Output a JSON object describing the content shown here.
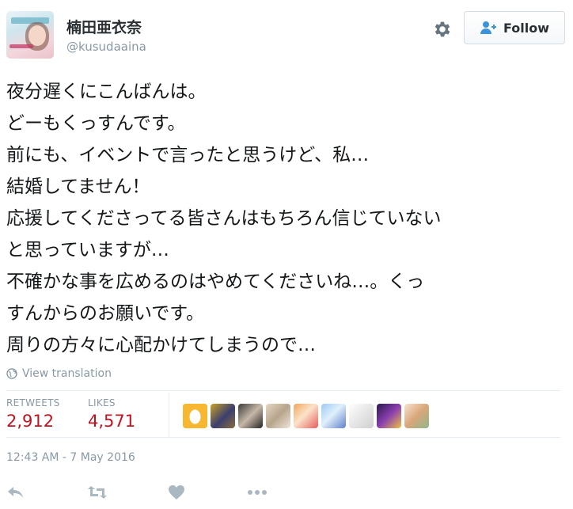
{
  "user": {
    "display_name": "楠田亜衣奈",
    "handle": "@kusudaaina"
  },
  "follow_button": {
    "label": "Follow"
  },
  "tweet": {
    "lines": [
      "夜分遅くにこんばんは。",
      "どーもくっすんです。",
      "前にも、イベントで言ったと思うけど、私…",
      "結婚してません！",
      "応援してくださってる皆さんはもちろん信じていない",
      "と思っていますが…",
      "不確かな事を広めるのはやめてくださいね…。くっ",
      "すんからのお願いです。",
      "周りの方々に心配かけてしまうので…"
    ]
  },
  "translation": {
    "label": "View translation",
    "icon": "globe-icon"
  },
  "stats": {
    "retweets_label": "RETWEETS",
    "retweets_count": "2,912",
    "likes_label": "LIKES",
    "likes_count": "4,571",
    "count_color": "#c1121f"
  },
  "liker_avatars": [
    "egg-avatar",
    "avatar-2",
    "avatar-3",
    "avatar-4",
    "avatar-5",
    "avatar-6",
    "avatar-7",
    "avatar-8",
    "avatar-9"
  ],
  "timestamp": "12:43 AM - 7 May 2016",
  "actions": [
    "reply-icon",
    "retweet-icon",
    "like-icon",
    "more-icon"
  ],
  "colors": {
    "muted": "#8899a6",
    "text": "#14171a",
    "divider": "#e6ecf0"
  }
}
